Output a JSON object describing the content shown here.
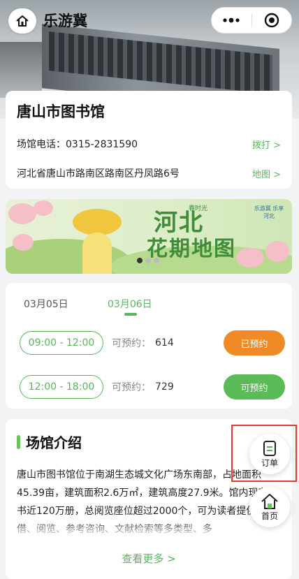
{
  "header": {
    "title": "乐游冀"
  },
  "venue": {
    "name": "唐山市图书馆",
    "phone_text": "场馆电话：0315-2831590",
    "call_label": "拨打 >",
    "address": "河北省唐山市路南区路南区丹凤路6号",
    "map_label": "地图 >"
  },
  "banner": {
    "title": "河北",
    "subtitle": "花期地图",
    "tag": "春时光",
    "logo_text": "乐游冀 乐享河北",
    "dots": 3,
    "active_dot": 0
  },
  "booking": {
    "dates": [
      "03月05日",
      "03月06日"
    ],
    "active_date": 1,
    "avail_label": "可预约：",
    "slots": [
      {
        "time": "09:00 - 12:00",
        "count": "614",
        "action": "已预约",
        "color": "#f08a24"
      },
      {
        "time": "12:00 - 18:00",
        "count": "729",
        "action": "可预约",
        "color": "#5bbb56"
      }
    ]
  },
  "intro": {
    "title": "场馆介绍",
    "text": "唐山市图书馆位于南湖生态城文化广场东南部，占地面积45.39亩，建筑面积2.6万㎡，建筑高度27.9米。馆内现有藏书近120万册，总阅览座位超过2000个，可为读者提供外借、阅览、参考咨询、文献检索等多类型、多",
    "more_label": "查看更多 >"
  },
  "float": {
    "order_label": "订单",
    "home_label": "首页"
  },
  "colors": {
    "accent": "#5bb55f",
    "booked": "#f08a24",
    "available": "#5bbb56",
    "highlight": "#e53935"
  }
}
